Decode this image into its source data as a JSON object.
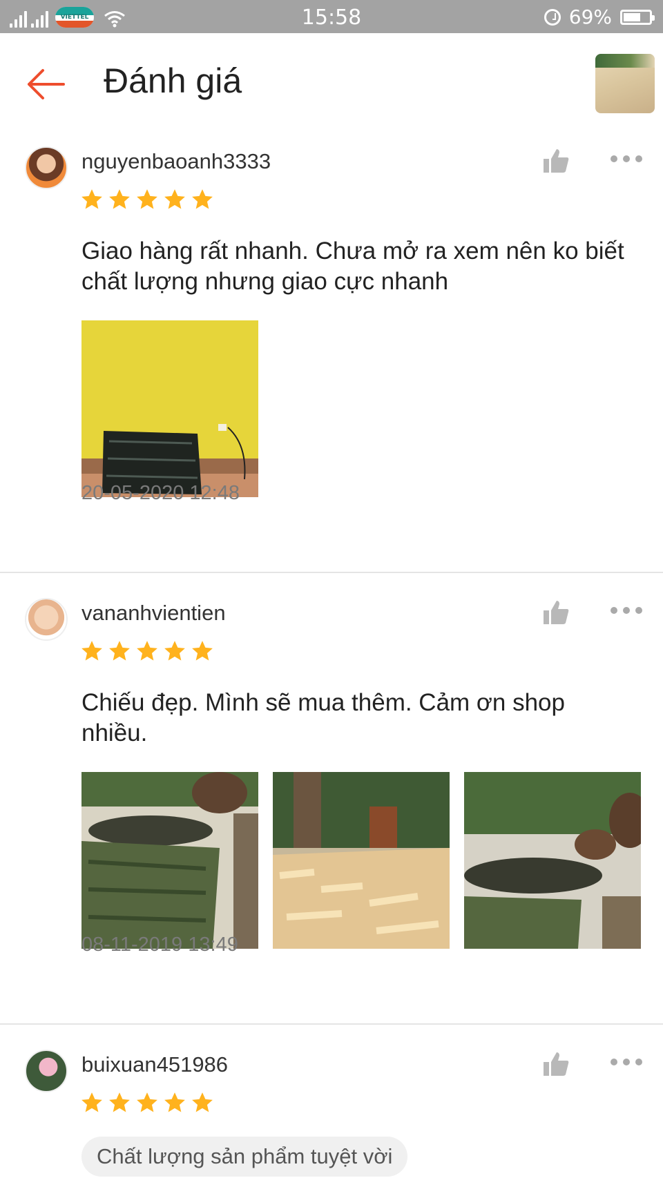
{
  "status_bar": {
    "time": "15:58",
    "battery": "69%",
    "carrier": "VIETTEL"
  },
  "header": {
    "title": "Đánh giá"
  },
  "reviews": [
    {
      "username": "nguyenbaoanh3333",
      "rating": 5,
      "text": "Giao hàng rất nhanh. Chưa mở ra xem nên ko biết chất lượng nhưng giao cực nhanh",
      "date": "20-05-2020 12:48"
    },
    {
      "username": "vananhvientien",
      "rating": 5,
      "text": "Chiếu đẹp. Mình sẽ mua thêm. Cảm ơn shop nhiều.",
      "date": "08-11-2019 13:49"
    },
    {
      "username": "buixuan451986",
      "rating": 5,
      "tag": "Chất lượng sản phẩm tuyệt vời"
    }
  ],
  "colors": {
    "accent": "#ee4d2d",
    "star": "#ffb21d",
    "statusbar": "#a3a3a3"
  },
  "icons": [
    "back-arrow-icon",
    "thumbs-up-icon",
    "more-options-icon",
    "star-icon",
    "wifi-icon",
    "alarm-icon",
    "battery-icon"
  ]
}
